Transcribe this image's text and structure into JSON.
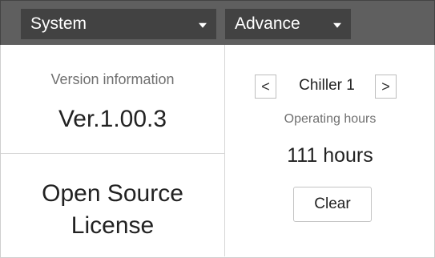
{
  "header": {
    "menu_dropdown": {
      "label": "System",
      "icon": "caret-down-icon"
    },
    "mode_dropdown": {
      "label": "Advance",
      "icon": "caret-down-icon"
    }
  },
  "left": {
    "version_label": "Version information",
    "version_value": "Ver.1.00.3",
    "license_line1": "Open Source",
    "license_line2": "License"
  },
  "right": {
    "prev_symbol": "<",
    "next_symbol": ">",
    "unit_name": "Chiller 1",
    "operating_label": "Operating hours",
    "operating_value": "111 hours",
    "clear_label": "Clear"
  },
  "colors": {
    "topbar": "#5f5f5f",
    "dropdown": "#424242",
    "secondary_text": "#707070"
  }
}
